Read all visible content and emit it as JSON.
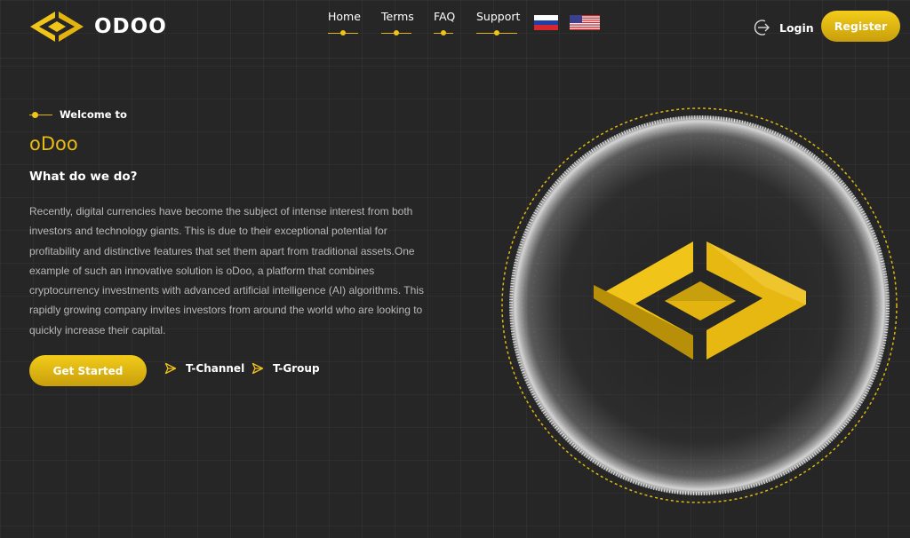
{
  "header": {
    "brand": "ODOO",
    "nav": [
      {
        "label": "Home"
      },
      {
        "label": "Terms"
      },
      {
        "label": "FAQ"
      },
      {
        "label": "Support"
      }
    ],
    "languages": [
      {
        "name": "Russian",
        "icon": "russia-flag-icon"
      },
      {
        "name": "English",
        "icon": "usa-flag-icon"
      }
    ],
    "login_label": "Login",
    "register_label": "Register"
  },
  "hero": {
    "welcome": "Welcome to",
    "brand_title": "oDoo",
    "subtitle": "What do we do?",
    "description": "Recently, digital currencies have become the subject of intense interest from both investors and technology giants. This is due to their exceptional potential for profitability and distinctive features that set them apart from traditional assets.One example of such an innovative solution is oDoo, a platform that combines cryptocurrency investments with advanced artificial intelligence (AI) algorithms. This rapidly growing company invites investors from around the world who are looking to quickly increase their capital.",
    "cta_label": "Get Started",
    "links": [
      {
        "label": "T-Channel",
        "icon": "send-icon"
      },
      {
        "label": "T-Group",
        "icon": "send-icon"
      }
    ]
  },
  "colors": {
    "background": "#262626",
    "accent": "#f0c419",
    "accent_dark": "#c89f0c",
    "text": "#ffffff",
    "muted_text": "#b8b8b8"
  }
}
